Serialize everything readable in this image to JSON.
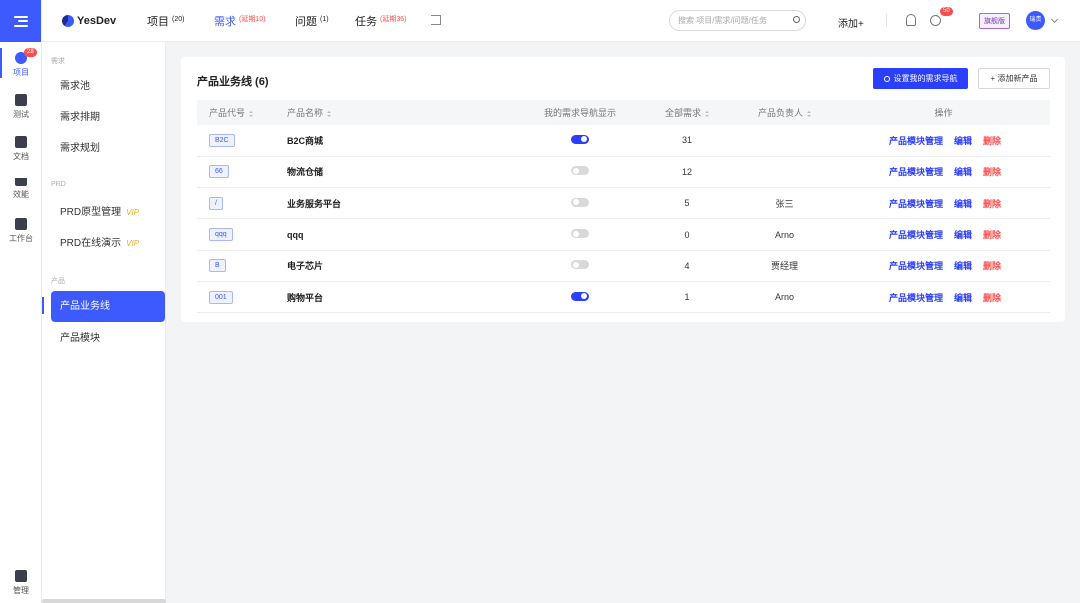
{
  "rail": {
    "items": [
      {
        "label": "项目",
        "badge": "28"
      },
      {
        "label": "测试"
      },
      {
        "label": "文档"
      },
      {
        "label": "效能"
      },
      {
        "label": "工作台"
      },
      {
        "label": "管理"
      }
    ]
  },
  "topbar": {
    "logo": "YesDev",
    "nav": [
      {
        "label": "项目",
        "count": "(20)"
      },
      {
        "label": "需求",
        "count": "(延期10)"
      },
      {
        "label": "问题",
        "count": "(1)"
      },
      {
        "label": "任务",
        "count": "(延期36)"
      }
    ],
    "search_placeholder": "搜索 项目/需求/问题/任务",
    "add_label": "添加+",
    "clock_badge": "50",
    "edition": "旗舰版",
    "avatar": "瑞贵"
  },
  "subnav": {
    "sections": [
      {
        "title": "需求",
        "items": [
          "需求池",
          "需求排期",
          "需求规划"
        ]
      },
      {
        "title": "PRD",
        "items": [
          "PRD原型管理",
          "PRD在线演示"
        ]
      },
      {
        "title": "产品",
        "items": [
          "产品业务线",
          "产品模块"
        ]
      }
    ],
    "vip": "VIP"
  },
  "main": {
    "title": "产品业务线 (6)",
    "set_nav_button": "设置我的需求导航",
    "add_product_button": "+ 添加新产品",
    "columns": [
      "产品代号",
      "产品名称",
      "我的需求导航显示",
      "全部需求",
      "产品负责人",
      "操作"
    ],
    "rows": [
      {
        "code": "B2C",
        "name": "B2C商城",
        "nav_show": true,
        "count": "31",
        "owner": ""
      },
      {
        "code": "66",
        "name": "物流仓储",
        "nav_show": false,
        "count": "12",
        "owner": ""
      },
      {
        "code": "/",
        "name": "业务服务平台",
        "nav_show": false,
        "count": "5",
        "owner": "张三"
      },
      {
        "code": "qqq",
        "name": "qqq",
        "nav_show": false,
        "count": "0",
        "owner": "Arno"
      },
      {
        "code": "B",
        "name": "电子芯片",
        "nav_show": false,
        "count": "4",
        "owner": "贾经理"
      },
      {
        "code": "001",
        "name": "购物平台",
        "nav_show": true,
        "count": "1",
        "owner": "Arno"
      }
    ],
    "actions": {
      "module": "产品模块管理",
      "edit": "编辑",
      "delete": "删除"
    }
  },
  "colors": {
    "accent": "#2b3ffe",
    "danger": "#ff4d4f",
    "vip": "#f5a623"
  }
}
